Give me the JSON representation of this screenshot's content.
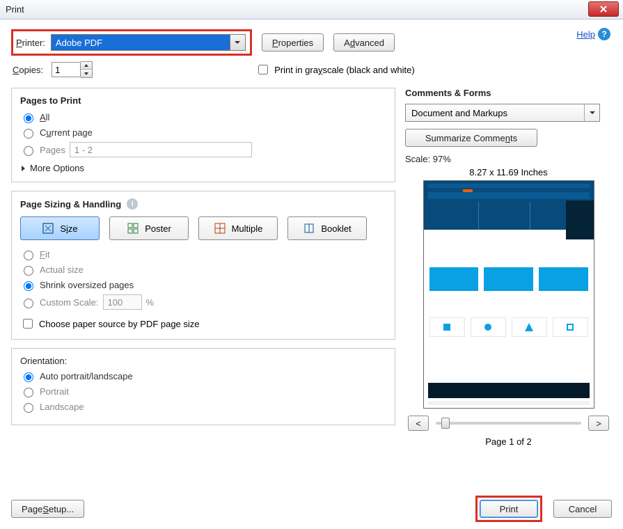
{
  "window": {
    "title": "Print"
  },
  "help_label": "Help",
  "printer": {
    "label": "Printer:",
    "selected": "Adobe PDF",
    "properties_btn": "Properties",
    "advanced_btn": "Advanced"
  },
  "copies": {
    "label": "Copies:",
    "value": "1",
    "grayscale_label": "Print in grayscale (black and white)"
  },
  "pages_to_print": {
    "title": "Pages to Print",
    "all": "All",
    "current": "Current page",
    "pages_label": "Pages",
    "pages_value": "1 - 2",
    "more_options": "More Options"
  },
  "sizing": {
    "title": "Page Sizing & Handling",
    "size": "Size",
    "poster": "Poster",
    "multiple": "Multiple",
    "booklet": "Booklet",
    "fit": "Fit",
    "actual": "Actual size",
    "shrink": "Shrink oversized pages",
    "custom_label": "Custom Scale:",
    "custom_value": "100",
    "custom_suffix": "%",
    "paper_source": "Choose paper source by PDF page size"
  },
  "orientation": {
    "title": "Orientation:",
    "auto": "Auto portrait/landscape",
    "portrait": "Portrait",
    "landscape": "Landscape"
  },
  "comments": {
    "title": "Comments & Forms",
    "selected": "Document and Markups",
    "summarize_btn": "Summarize Comments"
  },
  "preview": {
    "scale_label": "Scale:  97%",
    "dimensions": "8.27 x 11.69 Inches",
    "page_of": "Page 1 of 2"
  },
  "footer": {
    "page_setup": "Page Setup...",
    "print": "Print",
    "cancel": "Cancel"
  }
}
